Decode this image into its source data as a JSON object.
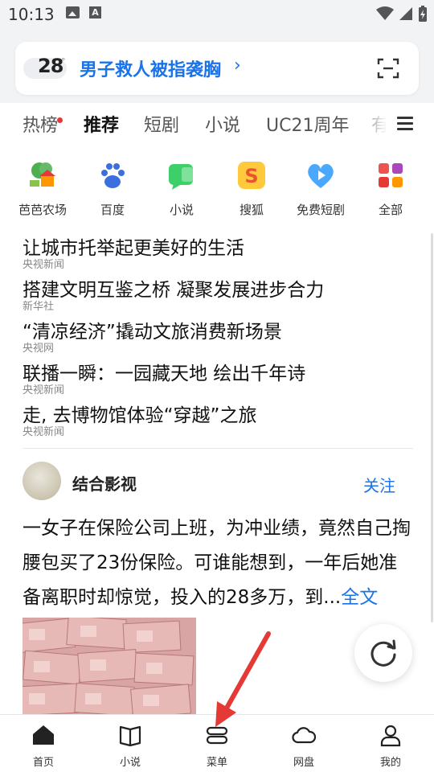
{
  "status_bar": {
    "time": "10:13"
  },
  "header": {
    "weather_temp": "28",
    "weather_degree": "°",
    "hot_query": "男子救人被指袭胸",
    "hot_arrow": "›"
  },
  "tabs": [
    {
      "label": "热榜"
    },
    {
      "label": "推荐"
    },
    {
      "label": "短剧"
    },
    {
      "label": "小说"
    },
    {
      "label": "UC21周年"
    },
    {
      "label": "有"
    }
  ],
  "shortcuts": [
    {
      "label": "芭芭农场",
      "icon": "farm-icon"
    },
    {
      "label": "百度",
      "icon": "baidu-paw-icon"
    },
    {
      "label": "小说",
      "icon": "novel-icon"
    },
    {
      "label": "搜狐",
      "icon": "sohu-icon"
    },
    {
      "label": "免费短剧",
      "icon": "heart-play-icon"
    },
    {
      "label": "全部",
      "icon": "all-apps-icon"
    }
  ],
  "news": [
    {
      "title": "让城市托举起更美好的生活",
      "source": "央视新闻"
    },
    {
      "title": "搭建文明互鉴之桥 凝聚发展进步合力",
      "source": "新华社"
    },
    {
      "title": "“清凉经济”撬动文旅消费新场景",
      "source": "央视网"
    },
    {
      "title": "联播一瞬：一园藏天地 绘出千年诗",
      "source": "央视新闻"
    },
    {
      "title": "走, 去博物馆体验“穿越”之旅",
      "source": "央视新闻"
    }
  ],
  "feed": {
    "author": "结合影视",
    "follow_label": "关注",
    "text": "一女子在保险公司上班，为冲业绩，竟然自己掏腰包买了23份保险。可谁能想到，一年后她准备离职时却惊觉，投入的28多万，到...",
    "more_label": "全文"
  },
  "bottom_nav": [
    {
      "label": "首页",
      "icon": "home-icon"
    },
    {
      "label": "小说",
      "icon": "book-icon"
    },
    {
      "label": "菜单",
      "icon": "menu-icon"
    },
    {
      "label": "网盘",
      "icon": "cloud-icon"
    },
    {
      "label": "我的",
      "icon": "user-icon"
    }
  ],
  "colors": {
    "accent": "#1a73e8",
    "header_bg": "#f2f3f5",
    "arrow": "#e53935"
  }
}
